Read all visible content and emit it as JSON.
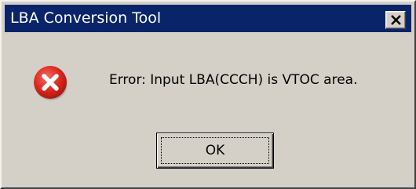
{
  "window": {
    "title": "LBA Conversion Tool",
    "close_icon": "close-icon"
  },
  "message": {
    "icon": "error-icon",
    "text": "Error: Input LBA(CCCH) is VTOC area."
  },
  "buttons": {
    "ok_label": "OK"
  },
  "colors": {
    "titlebar": "#0a246a",
    "face": "#d4d0c8",
    "error_red": "#d9261c"
  }
}
